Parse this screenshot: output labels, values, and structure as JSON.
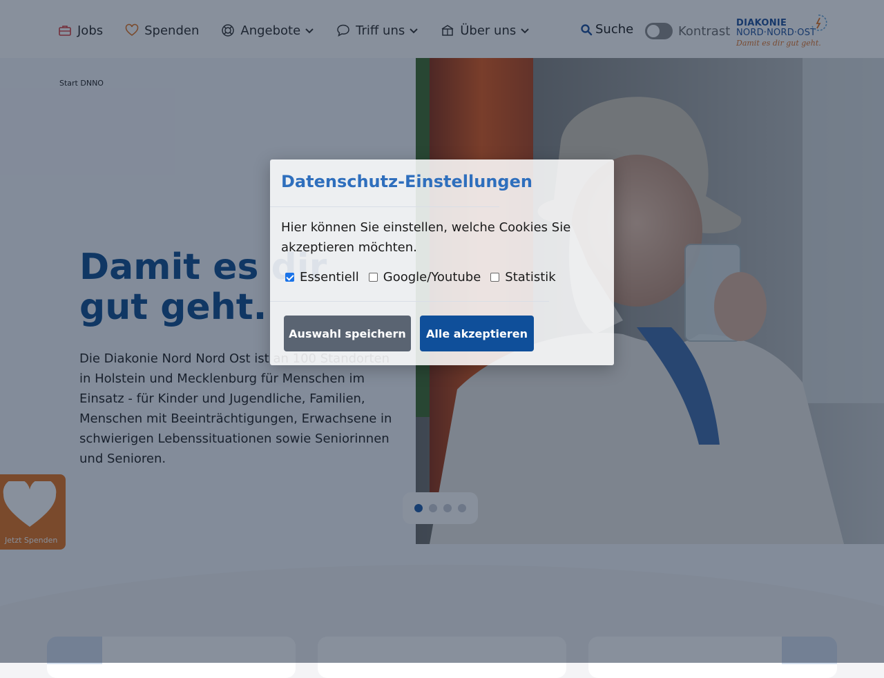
{
  "nav": {
    "items": [
      {
        "label": "Jobs",
        "icon": "briefcase-icon",
        "has_dropdown": false
      },
      {
        "label": "Spenden",
        "icon": "heart-icon",
        "has_dropdown": false
      },
      {
        "label": "Angebote",
        "icon": "lifebuoy-icon",
        "has_dropdown": true
      },
      {
        "label": "Triff uns",
        "icon": "speech-bubble-icon",
        "has_dropdown": true
      },
      {
        "label": "Über uns",
        "icon": "building-icon",
        "has_dropdown": true
      }
    ],
    "search_label": "Suche",
    "contrast_label": "Kontrast"
  },
  "logo": {
    "line1": "DIAKONIE",
    "line2": "NORD·NORD·OST",
    "tagline": "Damit es dir gut geht."
  },
  "breadcrumb": "Start DNNO",
  "hero": {
    "headline": "Damit es dir gut geht.",
    "text": "Die Diakonie Nord Nord Ost ist an 100 Standorten in Holstein und Mecklenburg für Menschen im Einsatz - für Kinder und Jugendliche, Familien, Menschen mit Beeinträchtigungen, Erwachsene in schwierigen Lebenssituationen sowie Seniorinnen und Senioren."
  },
  "slider": {
    "count": 4,
    "active": 0
  },
  "donate": {
    "label": "Jetzt Spenden"
  },
  "cookie_modal": {
    "title": "Datenschutz-Einstellungen",
    "text": "Hier können Sie einstellen, welche Cookies Sie akzeptieren möchten.",
    "options": [
      {
        "label": "Essentiell",
        "checked": true
      },
      {
        "label": "Google/Youtube",
        "checked": false
      },
      {
        "label": "Statistik",
        "checked": false
      }
    ],
    "save_label": "Auswahl speichern",
    "accept_label": "Alle akzeptieren"
  },
  "colors": {
    "primary": "#0f4d8f",
    "accent_orange": "#e2731f",
    "overlay": "#12213a"
  }
}
